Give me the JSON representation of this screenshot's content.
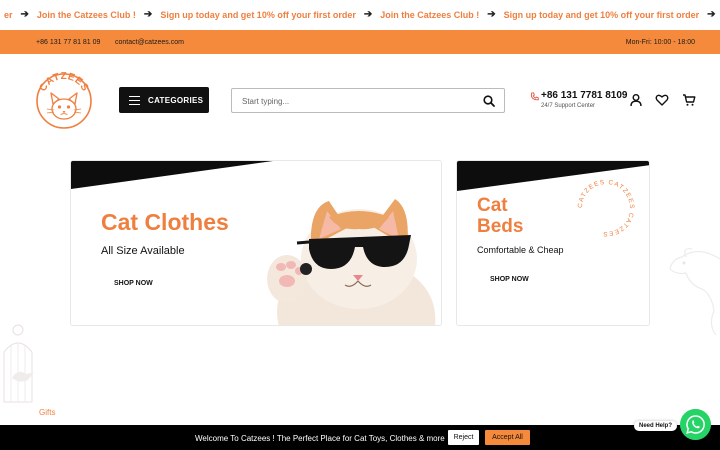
{
  "marquee": {
    "items": [
      {
        "text": "er",
        "arrow": "➔"
      },
      {
        "text": "Join the Catzees Club !",
        "arrow": "➔"
      },
      {
        "text": "Sign up today and get 10% off your first order",
        "arrow": "➔"
      },
      {
        "text": "Join the Catzees Club !",
        "arrow": "➔"
      },
      {
        "text": "Sign up today and get 10% off your first order",
        "arrow": "➔"
      },
      {
        "text": "Join the Catzees Club !",
        "arrow": "➔"
      },
      {
        "text": "Sign up today and get 10% off your first order",
        "arrow": ""
      }
    ]
  },
  "topbar": {
    "phone": "+86 131 77 81 81 09",
    "email": "contact@catzees.com",
    "hours": "Mon-Fri: 10:00 - 18:00"
  },
  "header": {
    "logo_text": "CATZEES",
    "categories_label": "CATEGORIES",
    "search_placeholder": "Start typing...",
    "support_phone": "+86 131 7781 8109",
    "support_label": "24/7 Support Center"
  },
  "banners": [
    {
      "title": "Cat Clothes",
      "subtitle": "All Size Available",
      "cta": "SHOP NOW"
    },
    {
      "title": "Cat Beds",
      "subtitle": "Comfortable & Cheap",
      "cta": "SHOP NOW",
      "stamp_text": "CATZEES CATZEES CATZEES"
    }
  ],
  "decor": {
    "gifts_label": "Gifts"
  },
  "cookie": {
    "message": "Welcome To Catzees ! The Perfect Place for Cat Toys, Clothes & more",
    "reject_label": "Reject",
    "accept_label": "Accept All"
  },
  "whatsapp": {
    "label": "Need Help?"
  },
  "colors": {
    "accent": "#f58a3c",
    "brand_text": "#ef7f3f",
    "dark": "#111111",
    "whatsapp": "#25d366"
  }
}
